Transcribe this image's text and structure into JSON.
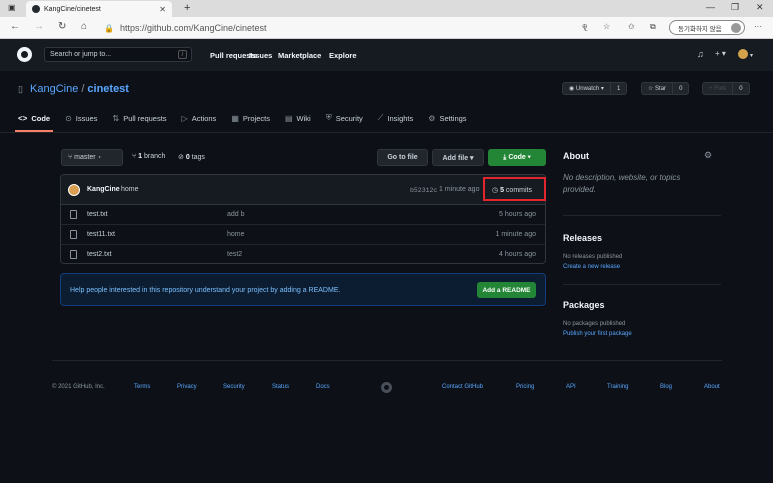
{
  "browser": {
    "tab_title": "KangCine/cinetest",
    "tab_close": "✕",
    "new_tab": "+",
    "url": "https://github.com/KangCine/cinetest",
    "url_lock": "🔒",
    "sync_label": "동기화하지 않음",
    "menu": "···",
    "win_min": "—",
    "win_max": "❐",
    "win_close": "✕"
  },
  "gh_header": {
    "search_placeholder": "Search or jump to...",
    "slash_key": "/",
    "nav": [
      "Pull requests",
      "Issues",
      "Marketplace",
      "Explore"
    ],
    "bell": "🔔",
    "plus": "+ ▾",
    "avatar_caret": "▾"
  },
  "repo": {
    "owner": "KangCine",
    "separator": "/",
    "name": "cinetest",
    "watch": {
      "label": "◉ Unwatch ▾",
      "count": "1"
    },
    "star": {
      "label": "☆ Star",
      "count": "0"
    },
    "fork": {
      "label": "⑂ Fork",
      "count": "0"
    },
    "tabs": [
      {
        "icon": "<>",
        "label": "Code"
      },
      {
        "icon": "⊙",
        "label": "Issues"
      },
      {
        "icon": "⇅",
        "label": "Pull requests"
      },
      {
        "icon": "▷",
        "label": "Actions"
      },
      {
        "icon": "▦",
        "label": "Projects"
      },
      {
        "icon": "▤",
        "label": "Wiki"
      },
      {
        "icon": "⛨",
        "label": "Security"
      },
      {
        "icon": "⟋",
        "label": "Insights"
      },
      {
        "icon": "⚙",
        "label": "Settings"
      }
    ]
  },
  "toolbar": {
    "branch": "⑂ master ▾",
    "branch_count": "1",
    "branch_label": "branch",
    "tag_count": "0",
    "tag_label": "tags",
    "go_to_file": "Go to file",
    "add_file": "Add file ▾",
    "code": "⤓ Code ▾"
  },
  "last_commit": {
    "author": "KangCine",
    "message": "home",
    "sha": "b52312c",
    "time": "1 minute ago",
    "commits_count": "5",
    "commits_label": "commits"
  },
  "files": [
    {
      "name": "test.txt",
      "message": "add b",
      "time": "5 hours ago"
    },
    {
      "name": "test11.txt",
      "message": "home",
      "time": "1 minute ago"
    },
    {
      "name": "test2.txt",
      "message": "test2",
      "time": "4 hours ago"
    }
  ],
  "readme_banner": {
    "text": "Help people interested in this repository understand your project by adding a README.",
    "button": "Add a README"
  },
  "sidebar": {
    "about_title": "About",
    "about_desc": "No description, website, or topics provided.",
    "releases_title": "Releases",
    "releases_empty": "No releases published",
    "releases_link": "Create a new release",
    "packages_title": "Packages",
    "packages_empty": "No packages published",
    "packages_link": "Publish your first package"
  },
  "footer": {
    "copyright": "© 2021 GitHub, Inc.",
    "links_left": [
      "Terms",
      "Privacy",
      "Security",
      "Status",
      "Docs"
    ],
    "links_right": [
      "Contact GitHub",
      "Pricing",
      "API",
      "Training",
      "Blog",
      "About"
    ]
  }
}
